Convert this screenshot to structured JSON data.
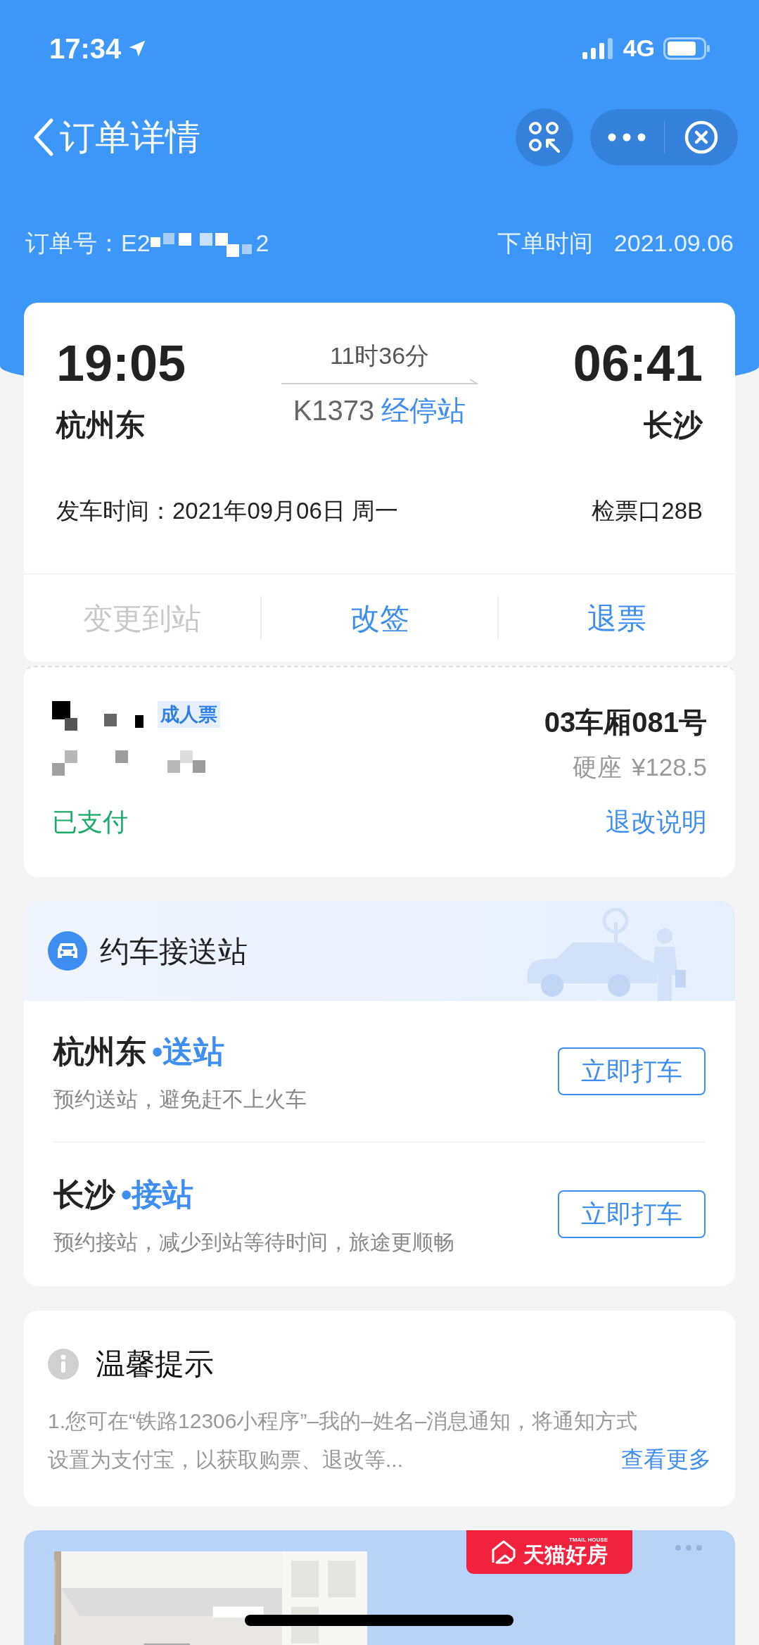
{
  "status_bar": {
    "time": "17:34",
    "network": "4G"
  },
  "nav": {
    "title": "订单详情"
  },
  "order": {
    "number_label": "订单号：",
    "number_start": "E2",
    "number_end": "2",
    "time_label": "下单时间",
    "time": "2021.09.06"
  },
  "trip": {
    "depart_time": "19:05",
    "depart_station": "杭州东",
    "duration": "11时36分",
    "train": "K1373",
    "stops_link": "经停站",
    "arrive_time": "06:41",
    "arrive_station": "长沙",
    "depart_date_label": "发车时间：",
    "depart_date": "2021年09月06日 周一",
    "gate": "检票口28B",
    "actions": [
      {
        "label": "变更到站",
        "disabled": true
      },
      {
        "label": "改签",
        "disabled": false
      },
      {
        "label": "退票",
        "disabled": false
      }
    ]
  },
  "passenger": {
    "ticket_type": "成人票",
    "seat": "03车厢081号",
    "seat_class": "硬座",
    "price": "¥128.5",
    "status": "已支付",
    "rules_link": "退改说明"
  },
  "ride": {
    "title": "约车接送站",
    "items": [
      {
        "station": "杭州东",
        "service": "•送站",
        "note": "预约送站，避免赶不上火车",
        "button": "立即打车"
      },
      {
        "station": "长沙",
        "service": "•接站",
        "note": "预约接站，减少到站等待时间，旅途更顺畅",
        "button": "立即打车"
      }
    ]
  },
  "tips": {
    "title": "温馨提示",
    "lines": [
      "1.您可在“铁路12306小程序”–我的–姓名–消息通知，将通知方式",
      "设置为支付宝，以获取购票、退改等..."
    ],
    "more_link": "查看更多"
  },
  "ad": {
    "brand": "天猫好房",
    "brand_sub": "TMAIL HOUSE",
    "kind": "picture"
  }
}
